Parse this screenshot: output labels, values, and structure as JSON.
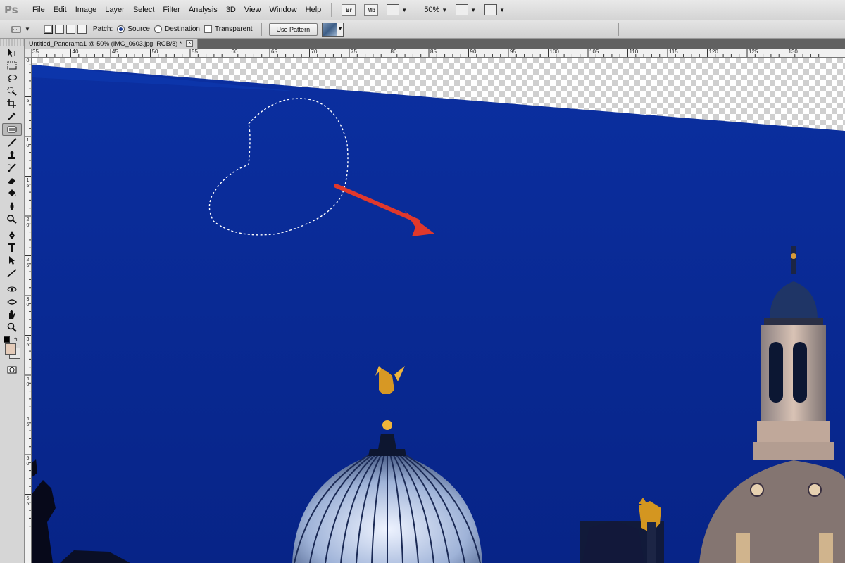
{
  "app": {
    "logo": "Ps"
  },
  "menu": {
    "items": [
      "File",
      "Edit",
      "Image",
      "Layer",
      "Select",
      "Filter",
      "Analysis",
      "3D",
      "View",
      "Window",
      "Help"
    ],
    "bridge_button": "Br",
    "minibridge_button": "Mb",
    "zoom": "50%"
  },
  "options": {
    "patch_label": "Patch:",
    "source_label": "Source",
    "destination_label": "Destination",
    "transparent_label": "Transparent",
    "use_pattern_label": "Use Pattern",
    "selected_mode": "Source"
  },
  "document": {
    "tab_title": "Untitled_Panorama1 @ 50% (IMG_0603.jpg, RGB/8) *",
    "close_glyph": "×"
  },
  "rulers": {
    "top": [
      "35",
      "40",
      "45",
      "50",
      "55",
      "60",
      "65",
      "70",
      "75",
      "80",
      "85",
      "90",
      "95",
      "100",
      "105",
      "110",
      "115",
      "120",
      "125",
      "130"
    ],
    "left": [
      "0",
      "5",
      "1\n0",
      "1\n5",
      "2\n0",
      "2\n5",
      "3\n0",
      "3\n5",
      "4\n0",
      "4\n5",
      "5\n0",
      "5\n5"
    ]
  },
  "colors": {
    "sky": "#0a2a94",
    "arrow": "#e0382c",
    "foreground": "#e4cbb9",
    "background": "#e6e6e6"
  },
  "tools": [
    "move-tool-icon",
    "marquee-tool-icon",
    "lasso-tool-icon",
    "quick-selection-icon",
    "crop-tool-icon",
    "eyedropper-icon",
    "patch-tool-icon",
    "brush-tool-icon",
    "clone-stamp-icon",
    "history-brush-icon",
    "eraser-icon",
    "paint-bucket-icon",
    "blur-tool-icon",
    "dodge-tool-icon",
    "pen-tool-icon",
    "type-tool-icon",
    "path-selection-icon",
    "line-tool-icon",
    "3d-rotate-icon",
    "3d-orbit-icon",
    "hand-tool-icon",
    "zoom-tool-icon"
  ]
}
